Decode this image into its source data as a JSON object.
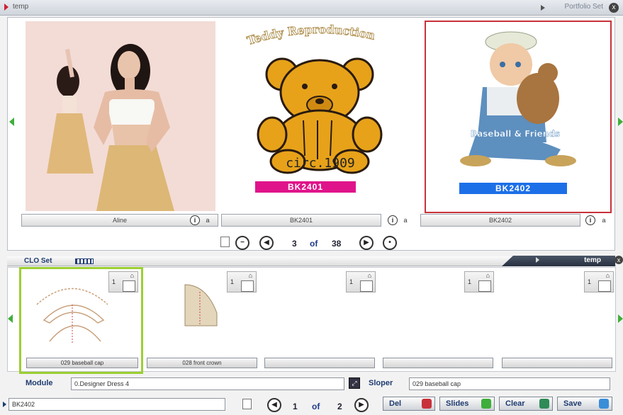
{
  "top_bar": {
    "title": "temp",
    "portfolio_label": "Portfolio Set",
    "close_glyph": "x"
  },
  "gallery": {
    "items": [
      {
        "caption": "Aline"
      },
      {
        "caption": "BK2401",
        "art_title": "Teddy Reproduction",
        "art_subtitle": "circ.1909",
        "tag": "BK2401",
        "tag_color": "#e0148a"
      },
      {
        "caption": "BK2402",
        "art_title": "Baseball & Friends",
        "tag": "BK2402",
        "tag_color": "#1d6fe8",
        "selected_color": "#c8313a"
      }
    ],
    "info_glyph": "i",
    "lock_glyph": "a",
    "pager": {
      "current": "3",
      "of_label": "of",
      "total": "38"
    }
  },
  "clo_set": {
    "label": "CLO Set",
    "tab_label": "temp",
    "thumbs": [
      {
        "caption": "029 baseball cap",
        "num": "1"
      },
      {
        "caption": "028 front crown",
        "num": "1"
      },
      {
        "caption": "",
        "num": "1"
      },
      {
        "caption": "",
        "num": "1"
      },
      {
        "caption": "",
        "num": "1"
      }
    ]
  },
  "module": {
    "label": "Module",
    "value": "0.Designer Dress 4"
  },
  "sloper": {
    "label": "Sloper",
    "value": "029 baseball cap"
  },
  "bottom": {
    "name_field": "BK2402",
    "pager": {
      "current": "1",
      "of_label": "of",
      "total": "2"
    },
    "buttons": {
      "del": "Del",
      "slides": "Slides",
      "clear": "Clear",
      "save": "Save"
    }
  },
  "colors": {
    "accent": "#1f3b70",
    "selected_red": "#c8313a",
    "selected_green": "#9ccf32",
    "nav_green": "#3fae3a"
  }
}
